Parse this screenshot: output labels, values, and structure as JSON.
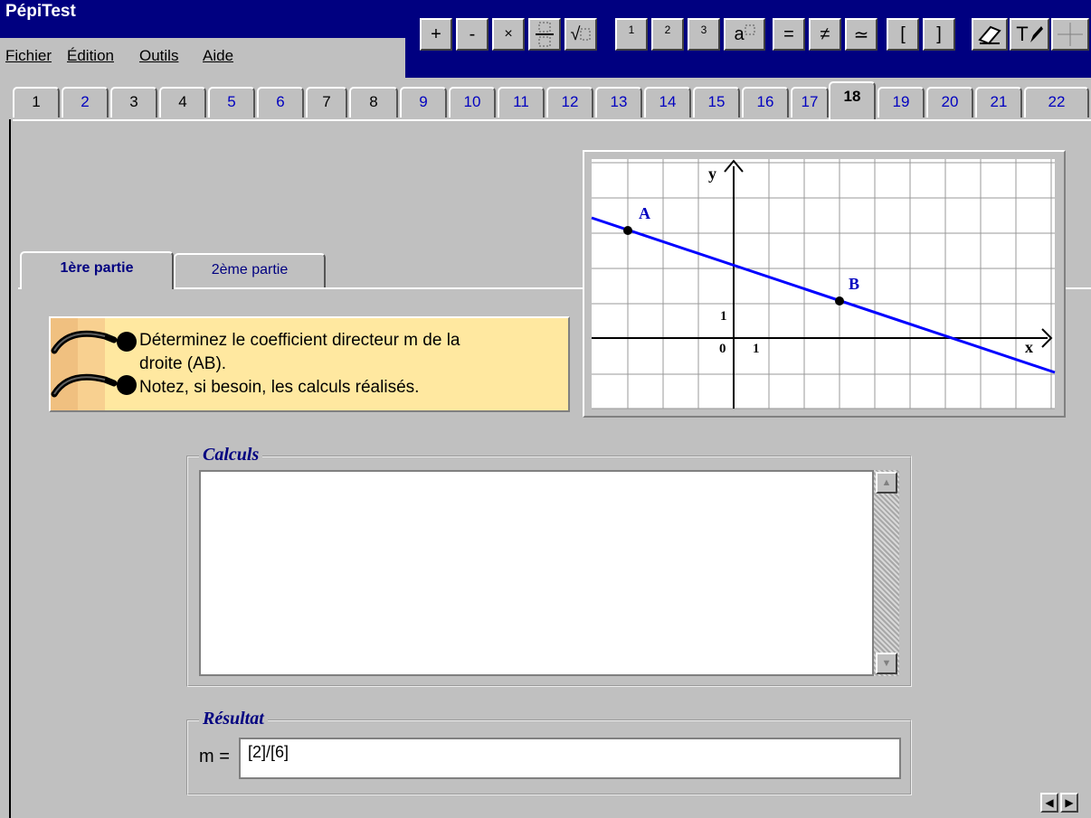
{
  "app": {
    "title": "PépiTest"
  },
  "menu": [
    "Fichier",
    "Édition",
    "Outils",
    "Aide"
  ],
  "toolbar": {
    "plus": "+",
    "minus": "-",
    "times": "×",
    "sqrt": "√",
    "exp1": "1",
    "exp2": "2",
    "exp3": "3",
    "power": "a",
    "equals": "=",
    "not_equal": "≠",
    "approx": "≃",
    "bracket_open": "[",
    "bracket_close": "]",
    "eraser": "eraser-icon",
    "text_pen": "T",
    "cross": "crosshair-icon"
  },
  "tabs": [
    "1",
    "2",
    "3",
    "4",
    "5",
    "6",
    "7",
    "8",
    "9",
    "10",
    "11",
    "12",
    "13",
    "14",
    "15",
    "16",
    "17",
    "18",
    "19",
    "20",
    "21",
    "22"
  ],
  "active_tab": "18",
  "subtabs": [
    "1ère partie",
    "2ème partie"
  ],
  "instruction": {
    "line1": "Déterminez le coefficient directeur m de la",
    "line2": "droite (AB).",
    "line3": "Notez, si besoin, les calculs réalisés."
  },
  "graph": {
    "point_a": "A",
    "point_b": "B",
    "axis_x": "x",
    "axis_y": "y",
    "origin": "0",
    "unit_x": "1",
    "unit_y": "1",
    "line_color": "#0000ff"
  },
  "calculs": {
    "legend": "Calculs",
    "value": ""
  },
  "resultat": {
    "legend": "Résultat",
    "label": "m =",
    "value": "[2]/[6]"
  },
  "nav": {
    "prev": "◀",
    "next": "▶"
  }
}
